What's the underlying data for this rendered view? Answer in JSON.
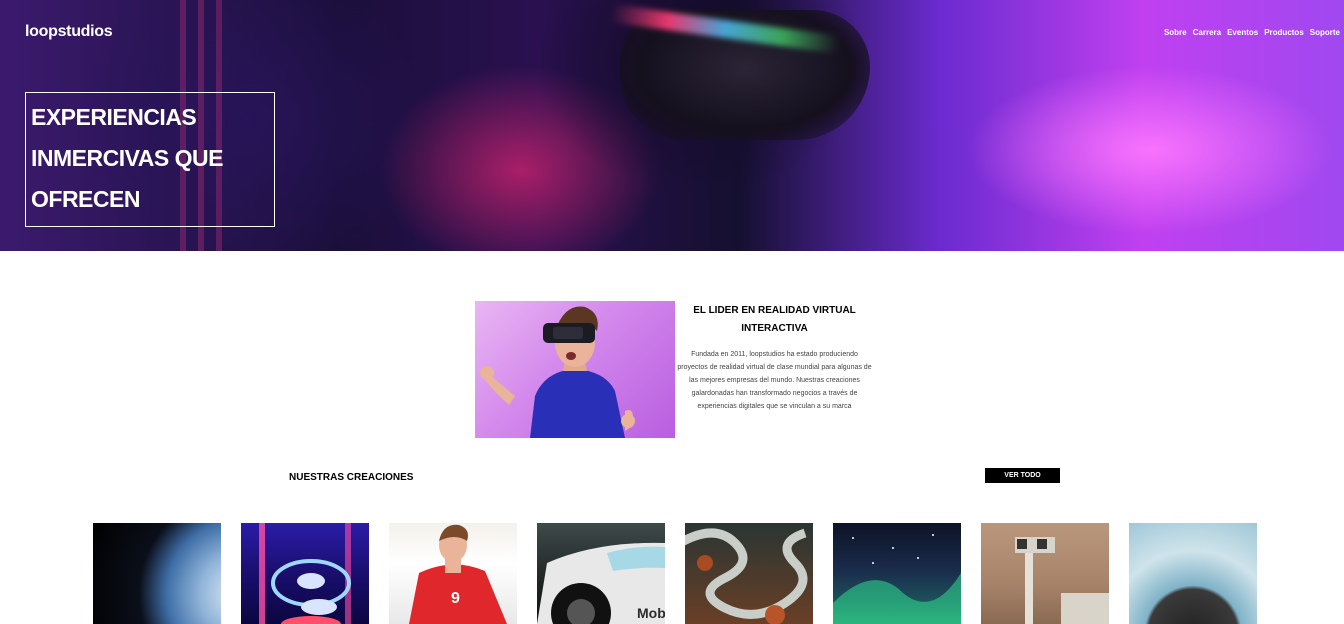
{
  "header": {
    "logo": "loopstudios",
    "menu": [
      "Sobre",
      "Carrera",
      "Eventos",
      "Productos",
      "Soporte"
    ]
  },
  "hero": {
    "title": "EXPERIENCIAS INMERCIVAS QUE OFRECEN"
  },
  "intro": {
    "heading": "EL LIDER EN REALIDAD VIRTUAL INTERACTIVA",
    "body": "Fundada en 2011, loopstudios ha estado produciendo proyectos de realidad virtual de clase mundial para algunas de las mejores empresas del mundo. Nuestras creaciones galardonadas han transformado negocios a través de experiencias digitales que se vinculan a su marca"
  },
  "creations": {
    "title": "NUESTRAS CREACIONES",
    "see_all": "VER TODO"
  },
  "colors": {
    "accent": "#000000",
    "hero_purple": "#a048f0",
    "hero_pink": "#ff40c0"
  }
}
